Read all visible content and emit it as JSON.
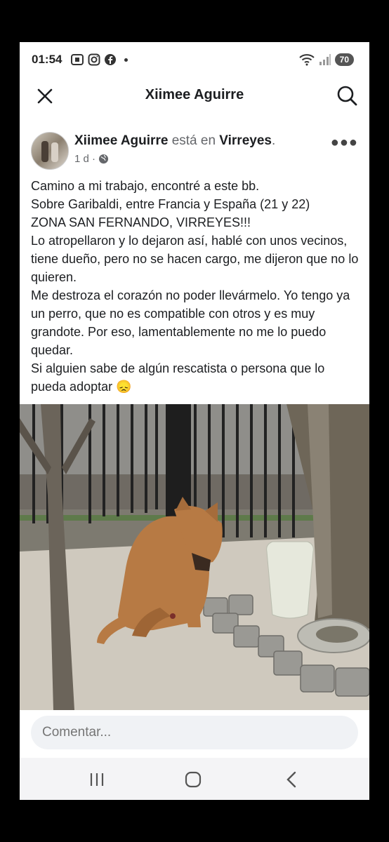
{
  "status_bar": {
    "time": "01:54",
    "battery": "70"
  },
  "header": {
    "title": "Xiimee Aguirre"
  },
  "post": {
    "author": "Xiimee Aguirre",
    "location_prefix": "está en",
    "location": "Virreyes",
    "location_suffix": ".",
    "time": "1 d ·",
    "text_lines": [
      "Camino a mi trabajo, encontré a este bb.",
      "Sobre Garibaldi, entre Francia y España (21 y 22)",
      "ZONA SAN FERNANDO, VIRREYES!!!",
      "Lo atropellaron y lo dejaron así, hablé con unos vecinos, tiene dueño, pero no se hacen cargo, me dijeron que no lo quieren.",
      "Me destroza el corazón no poder llevármelo. Yo tengo ya un perro, que no es compatible con otros y es muy grandote. Por eso, lamentablemente no me lo puedo quedar.",
      "Si alguien sabe de algún rescatista o persona que lo pueda adoptar 😞"
    ]
  },
  "comment": {
    "placeholder": "Comentar..."
  },
  "icons": {
    "close": "close-icon",
    "search": "search-icon",
    "more": "more-options-icon",
    "privacy": "globe-icon",
    "nav_recent": "recent-apps-icon",
    "nav_home": "home-icon",
    "nav_back": "back-icon"
  },
  "colors": {
    "primary_text": "#1c1e21",
    "secondary_text": "#65676b",
    "input_bg": "#f0f2f5"
  }
}
